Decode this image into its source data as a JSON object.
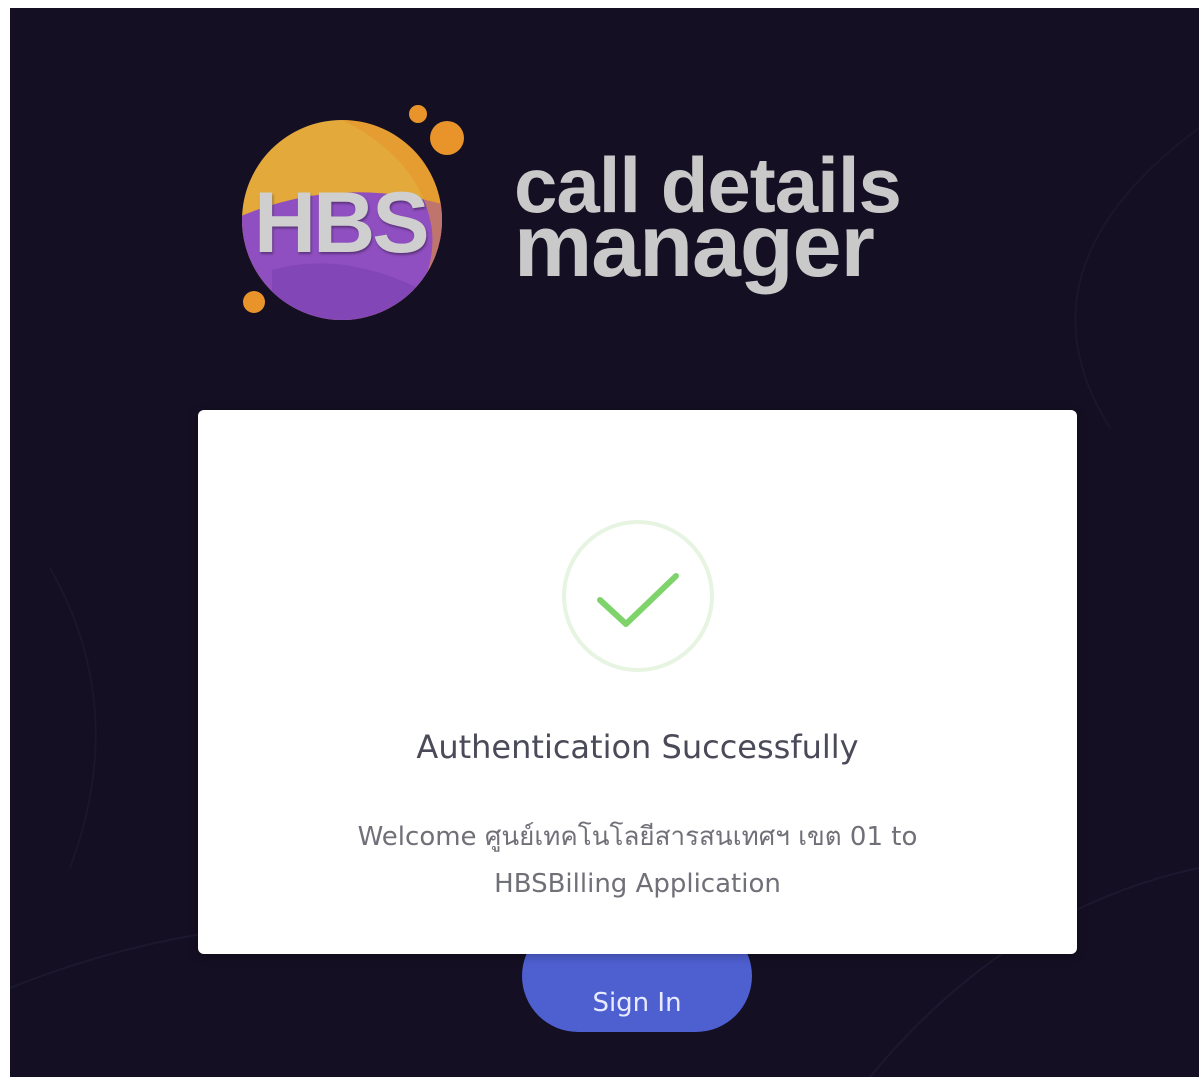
{
  "logo": {
    "abbr": "HBS",
    "line1": "call details",
    "line2": "manager",
    "colors": {
      "orange": "#e8942a",
      "gold": "#e3a93a",
      "purple": "#8f4fc0",
      "text": "#c9c9c9"
    }
  },
  "signin_button": {
    "label": "Sign In",
    "color": "#4e5fd0"
  },
  "dialog": {
    "icon": "check-icon",
    "icon_color": "#7ed46b",
    "title": "Authentication Successfully",
    "message": "Welcome ศูนย์เทคโนโลยีสารสนเทศฯ เขต 01 to HBSBilling Application"
  },
  "background_color": "#140f22"
}
